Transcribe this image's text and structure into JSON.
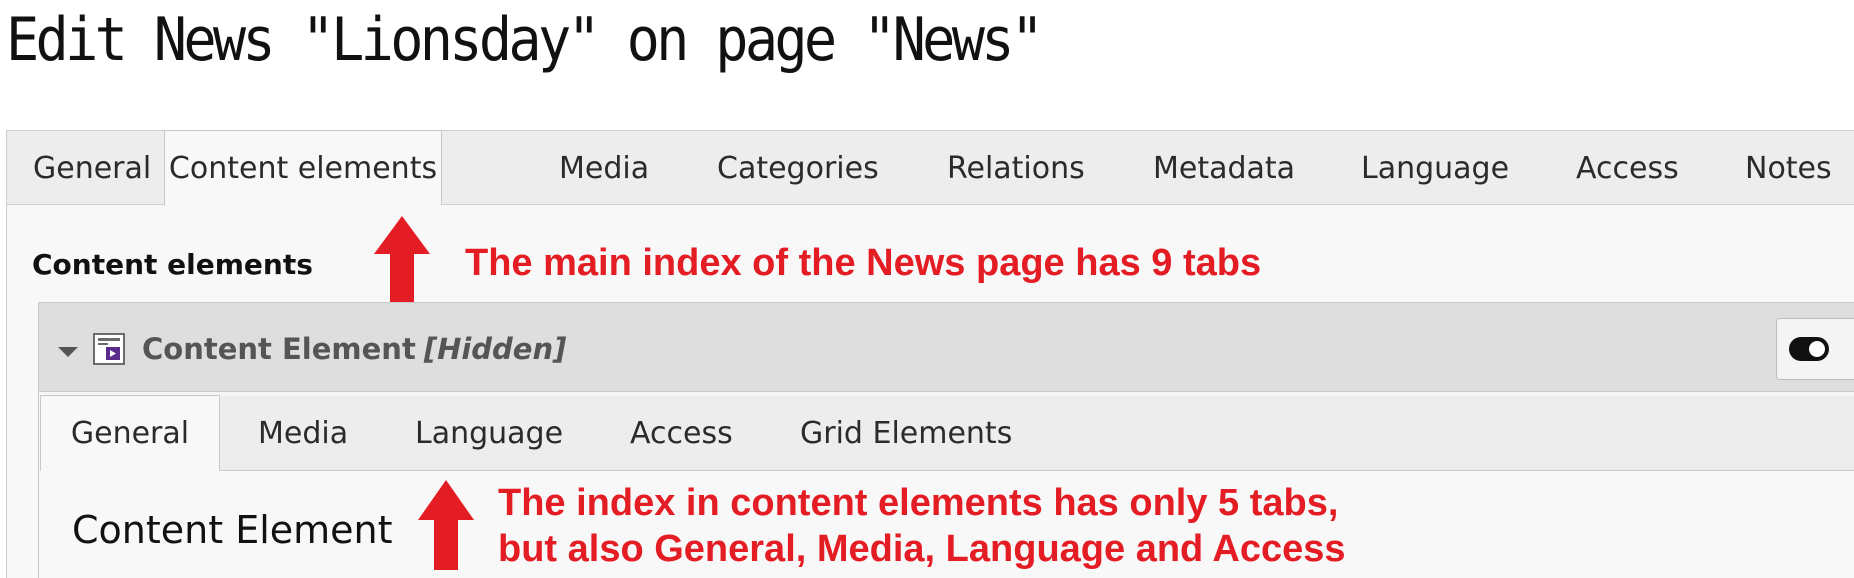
{
  "page_title": "Edit News \"Lionsday\" on page \"News\"",
  "main_tabs": [
    {
      "label": "General",
      "active": false
    },
    {
      "label": "Content elements",
      "active": true
    },
    {
      "label": "Media",
      "active": false
    },
    {
      "label": "Categories",
      "active": false
    },
    {
      "label": "Relations",
      "active": false
    },
    {
      "label": "Metadata",
      "active": false
    },
    {
      "label": "Language",
      "active": false
    },
    {
      "label": "Access",
      "active": false
    },
    {
      "label": "Notes",
      "active": false
    }
  ],
  "section_heading": "Content elements",
  "content_element": {
    "icon": "content-element-video-icon",
    "title": "Content Element",
    "hidden_flag": "[Hidden]",
    "toggle_icon": "toggle-on-icon",
    "inner_tabs": [
      {
        "label": "General",
        "active": true
      },
      {
        "label": "Media",
        "active": false
      },
      {
        "label": "Language",
        "active": false
      },
      {
        "label": "Access",
        "active": false
      },
      {
        "label": "Grid Elements",
        "active": false
      }
    ],
    "inner_heading": "Content Element"
  },
  "annotations": {
    "main_note": "The main index of the News page has 9 tabs",
    "inner_note_line1": "The index in content elements has only 5 tabs,",
    "inner_note_line2": "but also General, Media, Language and Access",
    "color": "#e41c23"
  }
}
